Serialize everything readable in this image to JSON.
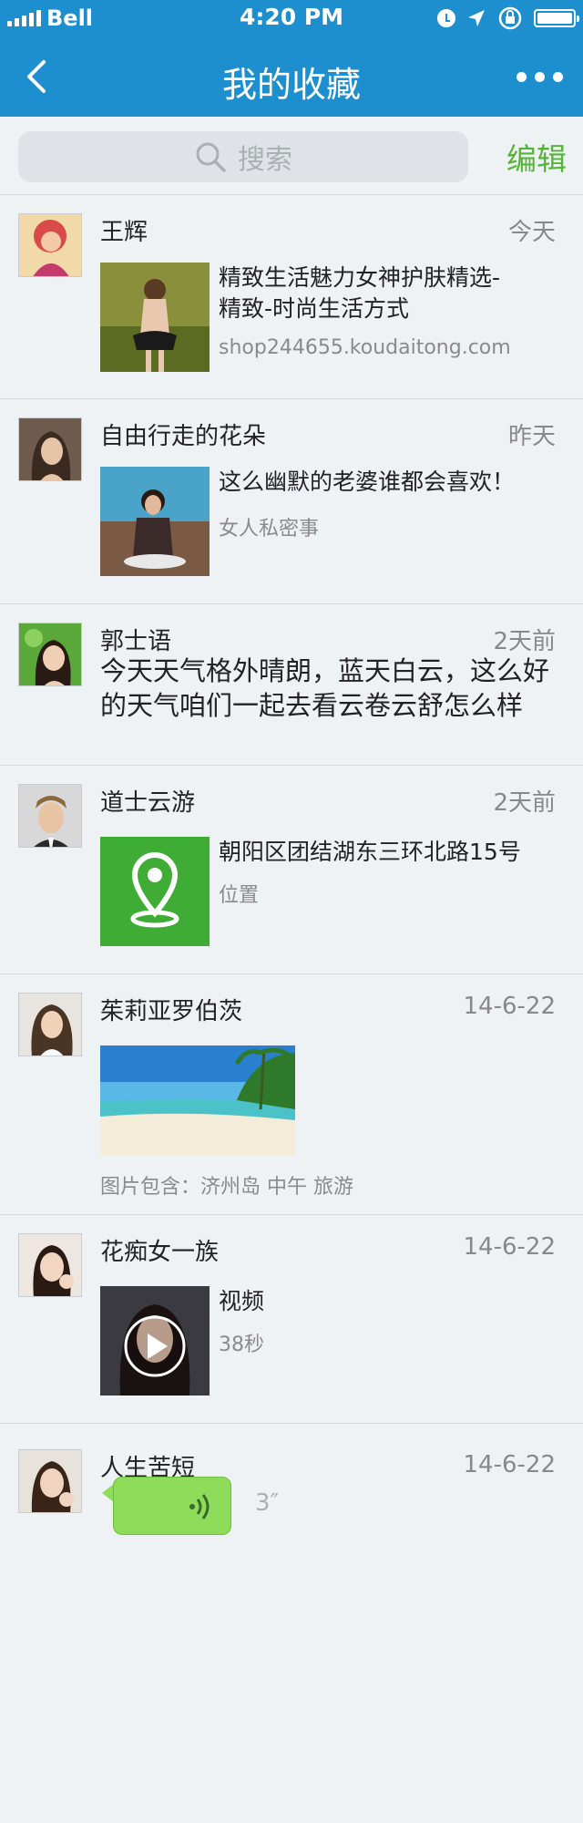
{
  "status_bar": {
    "carrier": "Bell",
    "time": "4:20 PM"
  },
  "nav": {
    "title": "我的收藏"
  },
  "search": {
    "placeholder": "搜索",
    "edit_label": "编辑"
  },
  "items": [
    {
      "name": "王辉",
      "time": "今天",
      "title": "精致生活魅力女神护肤精选-精致-时尚生活方式",
      "subtitle": "shop244655.koudaitong.com"
    },
    {
      "name": "自由行走的花朵",
      "time": "昨天",
      "title": "这么幽默的老婆谁都会喜欢！",
      "subtitle": "女人私密事"
    },
    {
      "name": "郭士语",
      "time": "2天前",
      "text": "今天天气格外晴朗，蓝天白云，这么好的天气咱们一起去看云卷云舒怎么样"
    },
    {
      "name": "道士云游",
      "time": "2天前",
      "title": "朝阳区团结湖东三环北路15号",
      "subtitle": "位置"
    },
    {
      "name": "茱莉亚罗伯茨",
      "time": "14-6-22",
      "caption": "图片包含：济州岛 中午 旅游"
    },
    {
      "name": "花痴女一族",
      "time": "14-6-22",
      "title": "视频",
      "subtitle": "38秒"
    },
    {
      "name": "人生苦短",
      "time": "14-6-22",
      "duration": "3″"
    }
  ],
  "colors": {
    "nav": "#1e8fce",
    "accent_green": "#54b438",
    "background": "#eff2f5"
  }
}
